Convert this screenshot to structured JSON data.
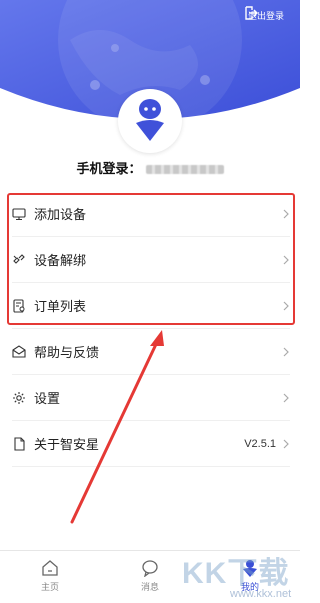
{
  "header": {
    "logout_label": "退出登录",
    "brand_gradient": [
      "#5b6ee8",
      "#3f51d9"
    ]
  },
  "profile": {
    "login_label": "手机登录：",
    "phone_masked": true
  },
  "menu": {
    "items": [
      {
        "label": "添加设备",
        "icon": "monitor-icon"
      },
      {
        "label": "设备解绑",
        "icon": "unbind-icon"
      },
      {
        "label": "订单列表",
        "icon": "order-list-icon"
      },
      {
        "label": "帮助与反馈",
        "icon": "feedback-icon"
      },
      {
        "label": "设置",
        "icon": "gear-icon"
      },
      {
        "label": "关于智安星",
        "icon": "document-icon",
        "value": "V2.5.1"
      }
    ]
  },
  "tabs": [
    {
      "label": "主页",
      "icon": "home-icon",
      "active": false
    },
    {
      "label": "消息",
      "icon": "message-icon",
      "active": false
    },
    {
      "label": "我的",
      "icon": "user-icon",
      "active": true
    }
  ],
  "annotation": {
    "highlight_color": "#e53935"
  },
  "watermark": {
    "text": "KK下载",
    "sub": "www.kkx.net"
  }
}
